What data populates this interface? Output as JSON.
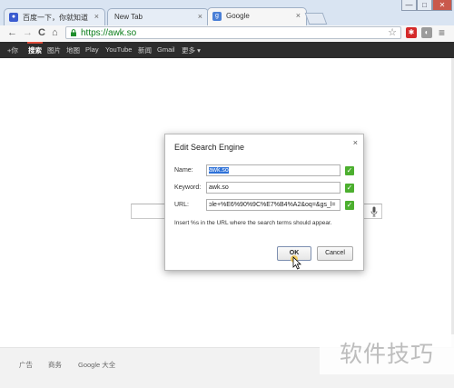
{
  "window": {
    "controls": [
      "—",
      "□",
      "✕"
    ]
  },
  "tabs": [
    {
      "title": "百度一下，你就知道",
      "icon": "baidu-paw-icon",
      "active": false
    },
    {
      "title": "New Tab",
      "icon": "",
      "active": false
    },
    {
      "title": "Google",
      "icon": "google-g-icon",
      "icon_glyph": "g",
      "active": true
    }
  ],
  "toolbar": {
    "back_icon": "←",
    "forward_icon": "→",
    "reload_icon": "C",
    "home_icon": "⌂",
    "url": "https://awk.so",
    "star_icon": "☆",
    "menu_icon": "≡"
  },
  "gbar": {
    "items": [
      "+你",
      "搜索",
      "图片",
      "地图",
      "Play",
      "YouTube",
      "新闻",
      "Gmail",
      "更多 ▾"
    ],
    "active_index": 1,
    "active_color": "#dd4b39"
  },
  "dialog": {
    "title": "Edit Search Engine",
    "close_icon": "×",
    "name_label": "Name:",
    "name_value": "awk.so",
    "keyword_label": "Keyword:",
    "keyword_value": "awk.so",
    "url_label": "URL:",
    "url_value": "ɔle+%E6%90%9C%E7%B4%A2&oq=&gs_l=",
    "check_glyph": "✓",
    "hint": "Insert %s in the URL where the search terms should appear.",
    "ok_label": "OK",
    "cancel_label": "Cancel",
    "check_color": "#4caf2f"
  },
  "footer": {
    "links": [
      "广告",
      "商务",
      "Google 大全"
    ]
  },
  "watermark": "软件技巧"
}
